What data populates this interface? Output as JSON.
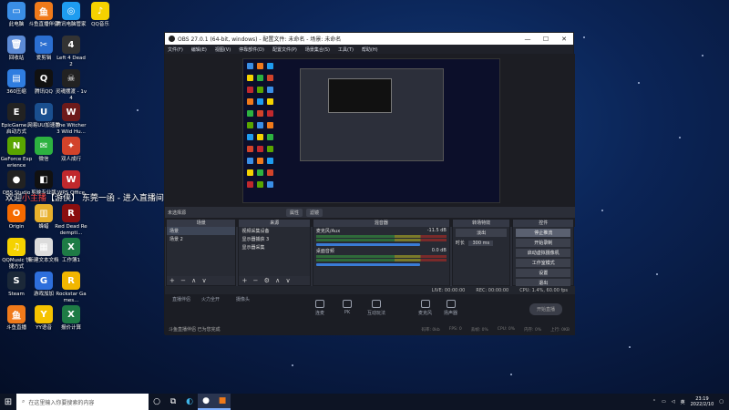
{
  "desktop": {
    "icons": [
      {
        "label": "此电脑",
        "color": "#3a8ee6",
        "glyph": "▭"
      },
      {
        "label": "斗鱼直播伴侣",
        "color": "#f07a1a",
        "glyph": "鱼"
      },
      {
        "label": "腾讯电脑管家",
        "color": "#1e9cf0",
        "glyph": "◎"
      },
      {
        "label": "QQ音乐",
        "color": "#f5d200",
        "glyph": "♪"
      },
      {
        "label": "回收站",
        "color": "#5c8bd6",
        "glyph": "🗑"
      },
      {
        "label": "爱剪辑",
        "color": "#2b6fd1",
        "glyph": "✂"
      },
      {
        "label": "Left 4 Dead 2",
        "color": "#333",
        "glyph": "4"
      },
      {
        "label": "360压缩",
        "color": "#2f7de0",
        "glyph": "▤"
      },
      {
        "label": "腾讯QQ",
        "color": "#111",
        "glyph": "Q"
      },
      {
        "label": "灵魂摆渡 - 1v4",
        "color": "#222",
        "glyph": "☠"
      },
      {
        "label": "EpicGame... 启动方式",
        "color": "#222",
        "glyph": "E"
      },
      {
        "label": "网易UU加速器",
        "color": "#1a4f8f",
        "glyph": "U"
      },
      {
        "label": "The Witcher 3 Wild Hu...",
        "color": "#6d1a1a",
        "glyph": "W"
      },
      {
        "label": "GeForce Experience",
        "color": "#5aa500",
        "glyph": "N"
      },
      {
        "label": "微信",
        "color": "#2db240",
        "glyph": "✉"
      },
      {
        "label": "双人成行",
        "color": "#d2432a",
        "glyph": "✦"
      },
      {
        "label": "OBS Studio",
        "color": "#222",
        "glyph": "●"
      },
      {
        "label": "剪映专业版",
        "color": "#111",
        "glyph": "◧"
      },
      {
        "label": "WPS Office",
        "color": "#c0282d",
        "glyph": "W"
      },
      {
        "label": "Origin",
        "color": "#f56a00",
        "glyph": "O"
      },
      {
        "label": "蜂蜡",
        "color": "#e8b02c",
        "glyph": "▥"
      },
      {
        "label": "Red Dead Redempti...",
        "color": "#8a0f0f",
        "glyph": "R"
      },
      {
        "label": "QQMusic 快捷方式",
        "color": "#f5d200",
        "glyph": "♫"
      },
      {
        "label": "新建文本文档",
        "color": "#dcdcdc",
        "glyph": "▦"
      },
      {
        "label": "工作簿1",
        "color": "#1e7b45",
        "glyph": "X"
      },
      {
        "label": "Steam",
        "color": "#1b2838",
        "glyph": "S"
      },
      {
        "label": "游戏加加",
        "color": "#2e6fdc",
        "glyph": "G"
      },
      {
        "label": "Rockstar Games...",
        "color": "#f2b600",
        "glyph": "R"
      },
      {
        "label": "斗鱼直播",
        "color": "#f07a1a",
        "glyph": "鱼"
      },
      {
        "label": "YY语音",
        "color": "#f5c200",
        "glyph": "Y"
      },
      {
        "label": "报价计算",
        "color": "#1e7b45",
        "glyph": "X"
      }
    ],
    "overlay_prefix": "欢迎",
    "overlay_highlight": "小主播",
    "overlay_suffix": "【游侠】 东莞一函 - 进入直播间"
  },
  "obs": {
    "title": "OBS 27.0.1 (64-bit, windows) - 配置文件: 未命名 - 场景: 未命名",
    "title_controls": {
      "minimize": "—",
      "maximize": "☐",
      "close": "✕"
    },
    "menu": [
      "文件(F)",
      "编辑(E)",
      "视图(V)",
      "停靠部件(D)",
      "配置文件(P)",
      "场景集合(S)",
      "工具(T)",
      "帮助(H)"
    ],
    "source_bar": {
      "label": "未选择源",
      "properties": "属性",
      "filters": "滤镜"
    },
    "docks": {
      "scenes": {
        "title": "场景",
        "items": [
          "场景",
          "场景 2"
        ],
        "footer": "+ − ∧ ∨"
      },
      "sources": {
        "title": "来源",
        "items": [
          "视频采集设备",
          "显示器捕获 3",
          "显示器采集"
        ],
        "footer": "+ − ⚙ ∧ ∨"
      },
      "mixer": {
        "title": "混音器",
        "channels": [
          {
            "name": "麦克风/Aux",
            "db": "-11.5 dB"
          },
          {
            "name": "桌面音频",
            "db": "0.0 dB"
          }
        ]
      },
      "transitions": {
        "title": "转场特效",
        "type": "淡出",
        "duration_label": "时长",
        "duration": "300 ms"
      },
      "controls": {
        "title": "控件",
        "buttons": [
          "停止推流",
          "开始录制",
          "启动虚拟摄像机",
          "工作室模式",
          "设置",
          "退出"
        ]
      }
    },
    "status": {
      "live": "LIVE: 00:00:00",
      "rec": "REC: 00:00:00",
      "cpu": "CPU: 1.4%, 60.00 fps"
    }
  },
  "streaming_tool": {
    "items": [
      "直播伴侣",
      "火力全开",
      "摄像头",
      "连麦",
      "PK",
      "互动玩法",
      "麦克风",
      "扬声器"
    ],
    "go_live": "开始直播",
    "note": "斗鱼直播伴侣 已为您完成",
    "stats": [
      "码率: 0kb",
      "FPS: 0",
      "丢帧: 0%",
      "CPU: 0%",
      "内存: 0%",
      "上行: 0KB"
    ]
  },
  "taskbar": {
    "search_placeholder": "在这里输入你要搜索的内容",
    "ime": "英",
    "time": "23:19",
    "date": "2022/2/10"
  }
}
